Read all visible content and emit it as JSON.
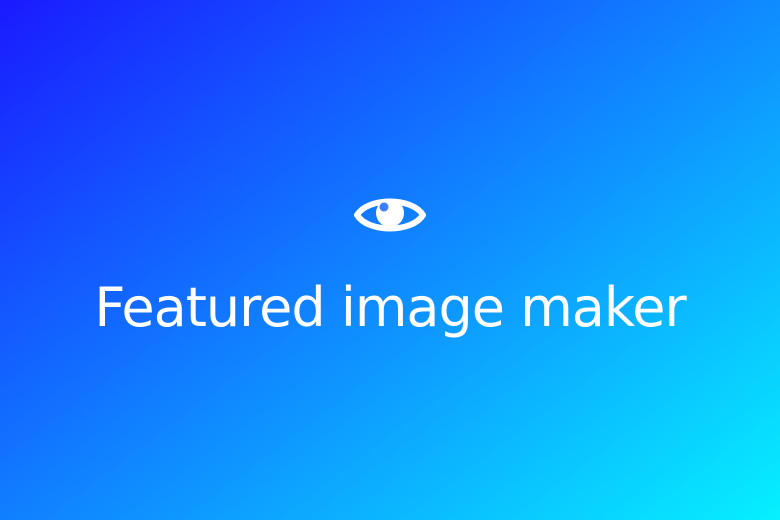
{
  "banner": {
    "title": "Featured image maker",
    "icon": "eye-icon"
  },
  "colors": {
    "gradient_start": "#1a1aff",
    "gradient_end": "#06f0ff",
    "foreground": "#ffffff"
  }
}
